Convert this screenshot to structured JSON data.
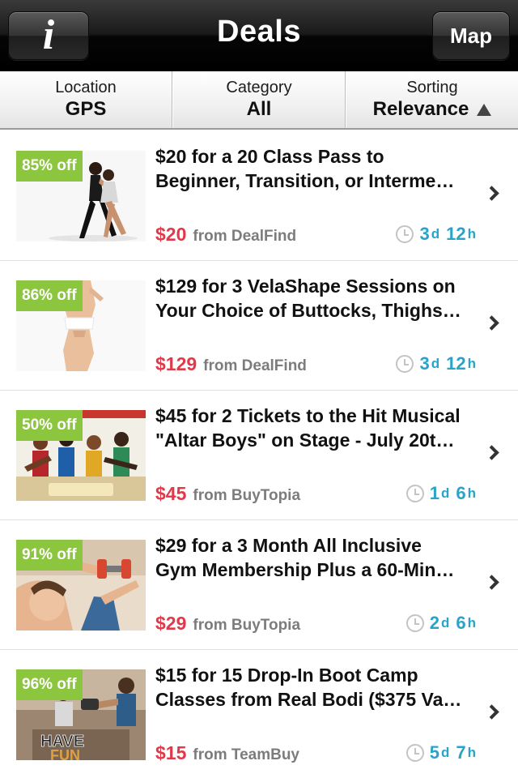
{
  "navbar": {
    "title": "Deals",
    "info_glyph": "i",
    "map_label": "Map"
  },
  "filters": [
    {
      "label": "Location",
      "value": "GPS"
    },
    {
      "label": "Category",
      "value": "All"
    },
    {
      "label": "Sorting",
      "value": "Relevance"
    }
  ],
  "deals": [
    {
      "badge": "85% off",
      "title_line1": "$20 for a 20 Class Pass to",
      "title_line2": "Beginner, Transition, or Interme…",
      "price": "$20",
      "source": "from DealFind",
      "days": "3",
      "day_unit": "d",
      "hours": "12",
      "hour_unit": "h",
      "image_icon": "dance-couple-image"
    },
    {
      "badge": "86% off",
      "title_line1": "$129 for 3 VelaShape Sessions on",
      "title_line2": "Your Choice of Buttocks, Thighs…",
      "price": "$129",
      "source": "from DealFind",
      "days": "3",
      "day_unit": "d",
      "hours": "12",
      "hour_unit": "h",
      "image_icon": "body-contour-image"
    },
    {
      "badge": "50% off",
      "title_line1": "$45 for 2 Tickets to the Hit Musical",
      "title_line2": "\"Altar Boys\" on Stage - July 20t…",
      "price": "$45",
      "source": "from BuyTopia",
      "days": "1",
      "day_unit": "d",
      "hours": "6",
      "hour_unit": "h",
      "image_icon": "musical-poster-image"
    },
    {
      "badge": "91% off",
      "title_line1": "$29 for a 3 Month All Inclusive",
      "title_line2": "Gym Membership Plus a 60-Min…",
      "price": "$29",
      "source": "from BuyTopia",
      "days": "2",
      "day_unit": "d",
      "hours": "6",
      "hour_unit": "h",
      "image_icon": "gym-dumbbell-image"
    },
    {
      "badge": "96% off",
      "title_line1": "$15 for 15 Drop-In Boot Camp",
      "title_line2": "Classes from Real Bodi ($375 Va…",
      "price": "$15",
      "source": "from TeamBuy",
      "days": "5",
      "day_unit": "d",
      "hours": "7",
      "hour_unit": "h",
      "image_icon": "bootcamp-have-fun-image",
      "image_text": "HAVE FUN"
    }
  ],
  "colors": {
    "badge": "#8cc63f",
    "price": "#e0394a",
    "timer": "#29a3c9",
    "source": "#7c7c7c"
  }
}
